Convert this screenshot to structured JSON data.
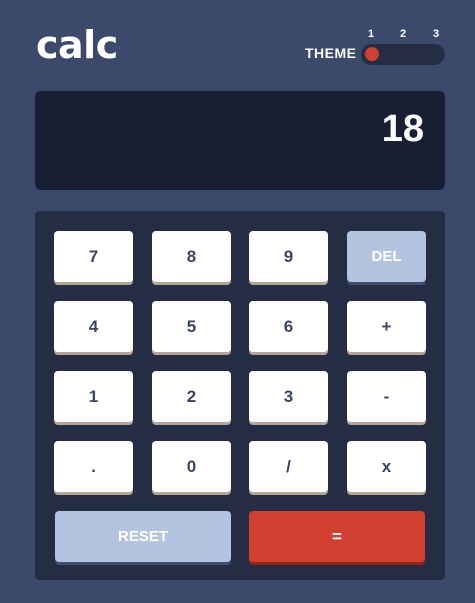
{
  "header": {
    "logo": "calc",
    "theme_label": "THEME",
    "theme_options": [
      "1",
      "2",
      "3"
    ],
    "theme_selected": 1
  },
  "screen": {
    "value": "18"
  },
  "keys": {
    "seven": "7",
    "eight": "8",
    "nine": "9",
    "del": "DEL",
    "four": "4",
    "five": "5",
    "six": "6",
    "plus": "+",
    "one": "1",
    "two": "2",
    "three": "3",
    "minus": "-",
    "dot": ".",
    "zero": "0",
    "divide": "/",
    "multiply": "x",
    "reset": "RESET",
    "equals": "="
  },
  "colors": {
    "background": "#3b4a6b",
    "screen": "#181f33",
    "keypad": "#242d44",
    "key": "#ffffff",
    "key_text": "#3b4664",
    "accent_blue": "#b2c4df",
    "accent_red": "#d03f2f"
  }
}
